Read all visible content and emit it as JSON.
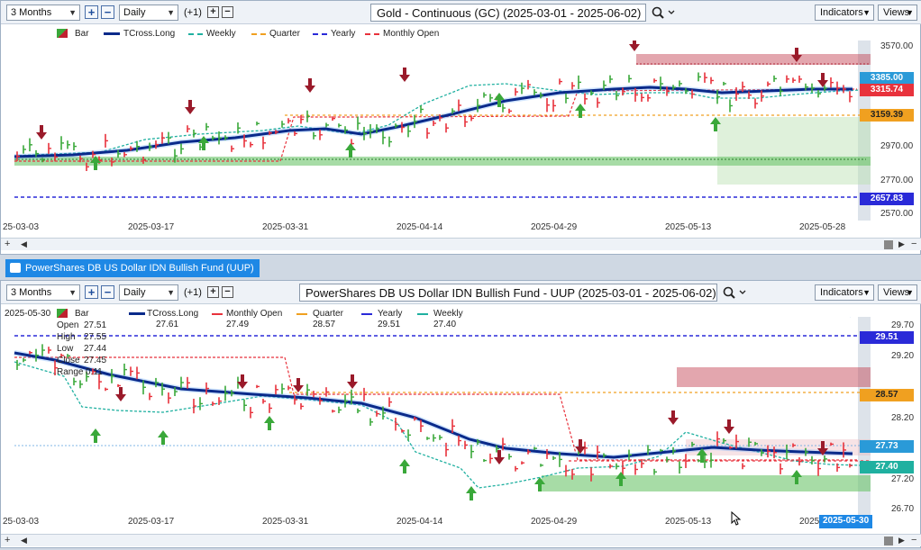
{
  "top": {
    "range": "3 Months",
    "interval": "Daily",
    "offset": "(+1)",
    "title": "Gold - Continuous (GC) (2025-03-01 - 2025-06-02)",
    "indicators_label": "Indicators",
    "views_label": "Views",
    "legend": [
      "Bar",
      "TCross.Long",
      "Weekly",
      "Quarter",
      "Yearly",
      "Monthly Open"
    ],
    "price_ticks": [
      "3570.00",
      "2970.00",
      "2770.00",
      "2570.00"
    ],
    "price_tags": [
      {
        "label": "3385.00",
        "color": "#2a9ad8"
      },
      {
        "label": "3315.74",
        "color": "#e8323c"
      },
      {
        "label": "3159.39",
        "color": "#f0a020"
      },
      {
        "label": "2657.83",
        "color": "#2a2ad8"
      }
    ],
    "date_ticks": [
      "25-03-03",
      "2025-03-17",
      "2025-03-31",
      "2025-04-14",
      "2025-04-29",
      "2025-05-13",
      "2025-05-28"
    ]
  },
  "bottom": {
    "tab_label": "PowerShares DB US Dollar IDN Bullish Fund (UUP)",
    "range": "3 Months",
    "interval": "Daily",
    "offset": "(+1)",
    "title": "PowerShares DB US Dollar IDN Bullish Fund - UUP (2025-03-01 - 2025-06-02)",
    "indicators_label": "Indicators",
    "views_label": "Views",
    "ohlc": {
      "date": "2025-05-30",
      "open_label": "Open",
      "open": "27.51",
      "high_label": "High",
      "high": "27.55",
      "low_label": "Low",
      "low": "27.44",
      "close_label": "Close",
      "close": "27.45",
      "range_label": "Range",
      "range": "0.11"
    },
    "legend": [
      {
        "name": "Bar",
        "value": ""
      },
      {
        "name": "TCross.Long",
        "value": "27.61"
      },
      {
        "name": "Monthly Open",
        "value": "27.49"
      },
      {
        "name": "Quarter",
        "value": "28.57"
      },
      {
        "name": "Yearly",
        "value": "29.51"
      },
      {
        "name": "Weekly",
        "value": "27.40"
      }
    ],
    "price_ticks": [
      "29.70",
      "29.20",
      "28.20",
      "27.20",
      "26.70"
    ],
    "price_tags": [
      {
        "label": "29.51",
        "color": "#2a2ad8"
      },
      {
        "label": "28.57",
        "color": "#f0a020"
      },
      {
        "label": "27.73",
        "color": "#2a9ad8"
      },
      {
        "label": "27.40",
        "color": "#1fb0a0"
      }
    ],
    "date_ticks": [
      "25-03-03",
      "2025-03-17",
      "2025-03-31",
      "2025-04-14",
      "2025-04-29",
      "2025-05-13",
      "2025"
    ],
    "cursor_date": "2025-05-30"
  },
  "colors": {
    "tcross": "#0a2a8a",
    "weekly": "#1fb0a0",
    "quarter": "#f0a020",
    "yearly": "#2a2ad8",
    "monthly": "#e8323c",
    "up": "#3aa83a",
    "down": "#9a1a2a"
  }
}
